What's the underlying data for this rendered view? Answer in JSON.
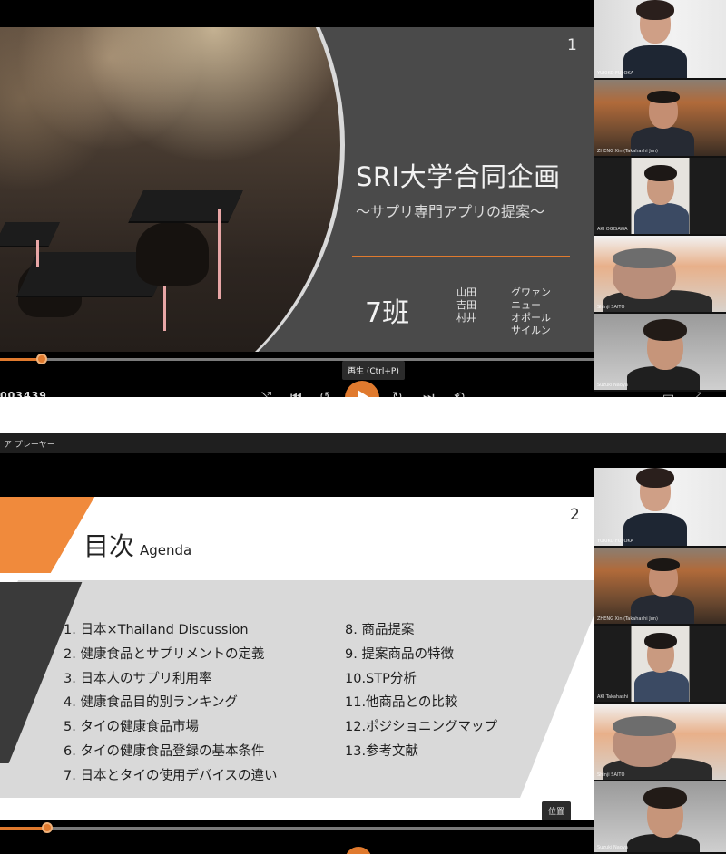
{
  "player1": {
    "slide": {
      "number": "1",
      "title": "SRI大学合同企画",
      "subtitle": "～サプリ専門アプリの提案～",
      "group": "7班",
      "members_left": [
        "山田",
        "吉田",
        "村井"
      ],
      "members_right": [
        "グワァン",
        "ニュー",
        "オポール",
        "サイルン"
      ]
    },
    "tooltip": "再生 (Ctrl+P)",
    "timecode": "003439",
    "progress_fraction": 0.07,
    "accent_color": "#e07a2e"
  },
  "player2": {
    "window_title": "ア プレーヤー",
    "slide": {
      "number": "2",
      "title": "目次",
      "title_en": "Agenda",
      "agenda_left": [
        "1. 日本×Thailand Discussion",
        "2. 健康食品とサプリメントの定義",
        "3. 日本人のサプリ利用率",
        "4. 健康食品目的別ランキング",
        "5. タイの健康食品市場",
        "6. タイの健康食品登録の基本条件",
        "7. 日本とタイの使用デバイスの違い"
      ],
      "agenda_right": [
        "8. 商品提案",
        "9. 提案商品の特徴",
        "10.STP分析",
        "11.他商品との比較",
        "12.ポジショニングマップ",
        "13.参考文献"
      ]
    },
    "position_button": "位置",
    "progress_fraction": 0.08
  },
  "participants_top": [
    {
      "name": "YUKIKO FUJIOKA"
    },
    {
      "name": "ZHENG Xin (Takahashi Jun)"
    },
    {
      "name": "AKI OGISAWA"
    },
    {
      "name": "Shinji SAITO"
    },
    {
      "name": "Suzuki Naoya"
    }
  ],
  "participants_bottom": [
    {
      "name": "YUKIKO FUJIOKA"
    },
    {
      "name": "ZHENG Xin (Takahashi Jun)"
    },
    {
      "name": "AKI Takahashi"
    },
    {
      "name": "Shinji SAITO"
    },
    {
      "name": "Suzuki Naoya"
    }
  ]
}
